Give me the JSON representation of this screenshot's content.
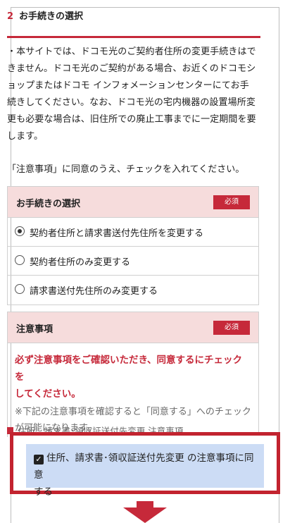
{
  "section": {
    "number": "2",
    "title": "お手続きの選択"
  },
  "intro_lines": [
    "・本サイトでは、ドコモ光のご契約者住所の変更手続きはで",
    "きません。ドコモ光のご契約がある場合、お近くのドコモシ",
    "ョップまたはドコモ インフォメーションセンターにてお手",
    "続きしてください。なお、ドコモ光の宅内機器の設置場所変",
    "更も必要な場合は、旧住所での廃止工事までに一定期間を要",
    "します。"
  ],
  "consent_note": "「注意事項」に同意のうえ、チェックを入れてください。",
  "procedure": {
    "label": "お手続きの選択",
    "required_badge": "必須",
    "options": [
      {
        "label": "契約者住所と請求書送付先住所を変更する",
        "selected": true
      },
      {
        "label": "契約者住所のみ変更する",
        "selected": false
      },
      {
        "label": "請求書送付先住所のみ変更する",
        "selected": false
      }
    ]
  },
  "notice": {
    "label": "注意事項",
    "required_badge": "必須",
    "warning_lines": [
      "必ず注意事項をご確認いただき、同意するにチェックを",
      "してください。"
    ],
    "hint_lines": [
      "※下記の注意事項を確認すると「同意する」へのチェック",
      "が可能になります。"
    ],
    "doc_link": "住所、請求書･領収証送付先変更 注意事項"
  },
  "agree": {
    "checked": true,
    "lines": [
      "住所、請求書･領収証送付先変更 の注意事項に同意",
      "する"
    ]
  },
  "colors": {
    "accent": "#c6293a",
    "header_bg": "#f6dcdc",
    "agree_bg": "#ccdcf5"
  },
  "icons": {
    "doc_link": "document-icon",
    "next": "arrow-down-icon"
  }
}
